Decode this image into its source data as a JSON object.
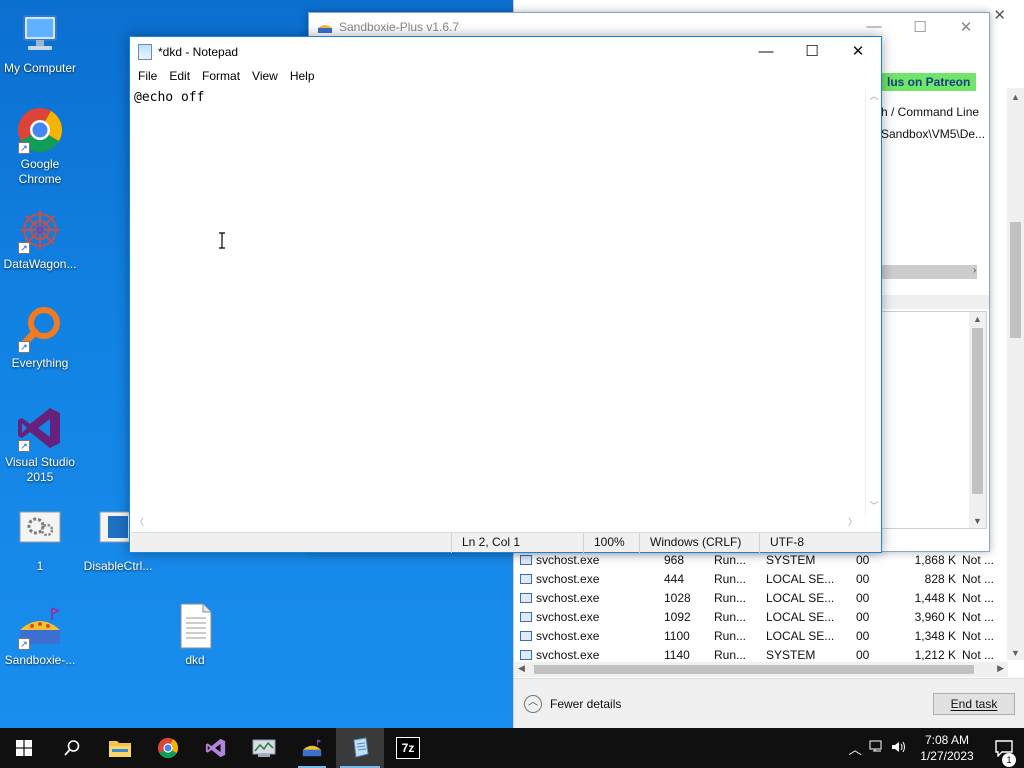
{
  "desktop": {
    "icons": [
      {
        "label": "My Computer"
      },
      {
        "label": "Google Chrome"
      },
      {
        "label": "DataWagon..."
      },
      {
        "label": "Everything"
      },
      {
        "label": "Visual Studio 2015"
      },
      {
        "label": "1"
      },
      {
        "label": "DisableCtrl..."
      },
      {
        "label": "Sandboxie-..."
      },
      {
        "label": "dkd"
      }
    ]
  },
  "sandboxie": {
    "title": "Sandboxie-Plus v1.6.7",
    "patreon": "lus on Patreon",
    "column_header": "h / Command Line",
    "column_value": "Sandbox\\VM5\\De..."
  },
  "taskmanager": {
    "rows": [
      {
        "name": "svchost.exe",
        "pid": "968",
        "status": "Run...",
        "user": "SYSTEM",
        "cpu": "00",
        "mem": "1,868 K",
        "uac": "Not ..."
      },
      {
        "name": "svchost.exe",
        "pid": "444",
        "status": "Run...",
        "user": "LOCAL SE...",
        "cpu": "00",
        "mem": "828 K",
        "uac": "Not ..."
      },
      {
        "name": "svchost.exe",
        "pid": "1028",
        "status": "Run...",
        "user": "LOCAL SE...",
        "cpu": "00",
        "mem": "1,448 K",
        "uac": "Not ..."
      },
      {
        "name": "svchost.exe",
        "pid": "1092",
        "status": "Run...",
        "user": "LOCAL SE...",
        "cpu": "00",
        "mem": "3,960 K",
        "uac": "Not ..."
      },
      {
        "name": "svchost.exe",
        "pid": "1100",
        "status": "Run...",
        "user": "LOCAL SE...",
        "cpu": "00",
        "mem": "1,348 K",
        "uac": "Not ..."
      },
      {
        "name": "svchost.exe",
        "pid": "1140",
        "status": "Run...",
        "user": "SYSTEM",
        "cpu": "00",
        "mem": "1,212 K",
        "uac": "Not ..."
      }
    ],
    "fewer_details": "Fewer details",
    "end_task": "End task"
  },
  "notepad": {
    "title": "*dkd - Notepad",
    "menu": [
      "File",
      "Edit",
      "Format",
      "View",
      "Help"
    ],
    "content": "@echo off",
    "status": {
      "position": "Ln 2, Col 1",
      "zoom": "100%",
      "line_ending": "Windows (CRLF)",
      "encoding": "UTF-8"
    }
  },
  "taskbar": {
    "clock_time": "7:08 AM",
    "clock_date": "1/27/2023",
    "notification_count": "1",
    "sevenzip_label": "7z"
  }
}
